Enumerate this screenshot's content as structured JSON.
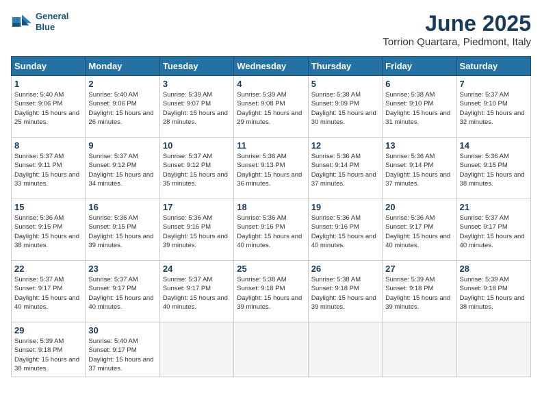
{
  "header": {
    "logo_line1": "General",
    "logo_line2": "Blue",
    "month": "June 2025",
    "location": "Torrion Quartara, Piedmont, Italy"
  },
  "columns": [
    "Sunday",
    "Monday",
    "Tuesday",
    "Wednesday",
    "Thursday",
    "Friday",
    "Saturday"
  ],
  "weeks": [
    [
      {
        "day": "1",
        "sunrise": "Sunrise: 5:40 AM",
        "sunset": "Sunset: 9:06 PM",
        "daylight": "Daylight: 15 hours and 25 minutes."
      },
      {
        "day": "2",
        "sunrise": "Sunrise: 5:40 AM",
        "sunset": "Sunset: 9:06 PM",
        "daylight": "Daylight: 15 hours and 26 minutes."
      },
      {
        "day": "3",
        "sunrise": "Sunrise: 5:39 AM",
        "sunset": "Sunset: 9:07 PM",
        "daylight": "Daylight: 15 hours and 28 minutes."
      },
      {
        "day": "4",
        "sunrise": "Sunrise: 5:39 AM",
        "sunset": "Sunset: 9:08 PM",
        "daylight": "Daylight: 15 hours and 29 minutes."
      },
      {
        "day": "5",
        "sunrise": "Sunrise: 5:38 AM",
        "sunset": "Sunset: 9:09 PM",
        "daylight": "Daylight: 15 hours and 30 minutes."
      },
      {
        "day": "6",
        "sunrise": "Sunrise: 5:38 AM",
        "sunset": "Sunset: 9:10 PM",
        "daylight": "Daylight: 15 hours and 31 minutes."
      },
      {
        "day": "7",
        "sunrise": "Sunrise: 5:37 AM",
        "sunset": "Sunset: 9:10 PM",
        "daylight": "Daylight: 15 hours and 32 minutes."
      }
    ],
    [
      {
        "day": "8",
        "sunrise": "Sunrise: 5:37 AM",
        "sunset": "Sunset: 9:11 PM",
        "daylight": "Daylight: 15 hours and 33 minutes."
      },
      {
        "day": "9",
        "sunrise": "Sunrise: 5:37 AM",
        "sunset": "Sunset: 9:12 PM",
        "daylight": "Daylight: 15 hours and 34 minutes."
      },
      {
        "day": "10",
        "sunrise": "Sunrise: 5:37 AM",
        "sunset": "Sunset: 9:12 PM",
        "daylight": "Daylight: 15 hours and 35 minutes."
      },
      {
        "day": "11",
        "sunrise": "Sunrise: 5:36 AM",
        "sunset": "Sunset: 9:13 PM",
        "daylight": "Daylight: 15 hours and 36 minutes."
      },
      {
        "day": "12",
        "sunrise": "Sunrise: 5:36 AM",
        "sunset": "Sunset: 9:14 PM",
        "daylight": "Daylight: 15 hours and 37 minutes."
      },
      {
        "day": "13",
        "sunrise": "Sunrise: 5:36 AM",
        "sunset": "Sunset: 9:14 PM",
        "daylight": "Daylight: 15 hours and 37 minutes."
      },
      {
        "day": "14",
        "sunrise": "Sunrise: 5:36 AM",
        "sunset": "Sunset: 9:15 PM",
        "daylight": "Daylight: 15 hours and 38 minutes."
      }
    ],
    [
      {
        "day": "15",
        "sunrise": "Sunrise: 5:36 AM",
        "sunset": "Sunset: 9:15 PM",
        "daylight": "Daylight: 15 hours and 38 minutes."
      },
      {
        "day": "16",
        "sunrise": "Sunrise: 5:36 AM",
        "sunset": "Sunset: 9:15 PM",
        "daylight": "Daylight: 15 hours and 39 minutes."
      },
      {
        "day": "17",
        "sunrise": "Sunrise: 5:36 AM",
        "sunset": "Sunset: 9:16 PM",
        "daylight": "Daylight: 15 hours and 39 minutes."
      },
      {
        "day": "18",
        "sunrise": "Sunrise: 5:36 AM",
        "sunset": "Sunset: 9:16 PM",
        "daylight": "Daylight: 15 hours and 40 minutes."
      },
      {
        "day": "19",
        "sunrise": "Sunrise: 5:36 AM",
        "sunset": "Sunset: 9:16 PM",
        "daylight": "Daylight: 15 hours and 40 minutes."
      },
      {
        "day": "20",
        "sunrise": "Sunrise: 5:36 AM",
        "sunset": "Sunset: 9:17 PM",
        "daylight": "Daylight: 15 hours and 40 minutes."
      },
      {
        "day": "21",
        "sunrise": "Sunrise: 5:37 AM",
        "sunset": "Sunset: 9:17 PM",
        "daylight": "Daylight: 15 hours and 40 minutes."
      }
    ],
    [
      {
        "day": "22",
        "sunrise": "Sunrise: 5:37 AM",
        "sunset": "Sunset: 9:17 PM",
        "daylight": "Daylight: 15 hours and 40 minutes."
      },
      {
        "day": "23",
        "sunrise": "Sunrise: 5:37 AM",
        "sunset": "Sunset: 9:17 PM",
        "daylight": "Daylight: 15 hours and 40 minutes."
      },
      {
        "day": "24",
        "sunrise": "Sunrise: 5:37 AM",
        "sunset": "Sunset: 9:17 PM",
        "daylight": "Daylight: 15 hours and 40 minutes."
      },
      {
        "day": "25",
        "sunrise": "Sunrise: 5:38 AM",
        "sunset": "Sunset: 9:18 PM",
        "daylight": "Daylight: 15 hours and 39 minutes."
      },
      {
        "day": "26",
        "sunrise": "Sunrise: 5:38 AM",
        "sunset": "Sunset: 9:18 PM",
        "daylight": "Daylight: 15 hours and 39 minutes."
      },
      {
        "day": "27",
        "sunrise": "Sunrise: 5:39 AM",
        "sunset": "Sunset: 9:18 PM",
        "daylight": "Daylight: 15 hours and 39 minutes."
      },
      {
        "day": "28",
        "sunrise": "Sunrise: 5:39 AM",
        "sunset": "Sunset: 9:18 PM",
        "daylight": "Daylight: 15 hours and 38 minutes."
      }
    ],
    [
      {
        "day": "29",
        "sunrise": "Sunrise: 5:39 AM",
        "sunset": "Sunset: 9:18 PM",
        "daylight": "Daylight: 15 hours and 38 minutes."
      },
      {
        "day": "30",
        "sunrise": "Sunrise: 5:40 AM",
        "sunset": "Sunset: 9:17 PM",
        "daylight": "Daylight: 15 hours and 37 minutes."
      },
      null,
      null,
      null,
      null,
      null
    ]
  ]
}
